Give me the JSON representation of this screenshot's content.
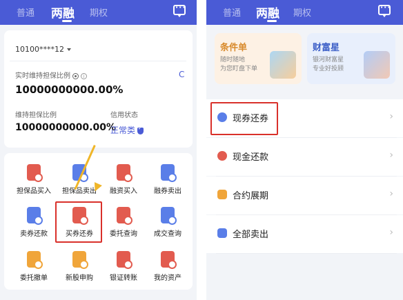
{
  "tabs": [
    "普通",
    "两融",
    "期权"
  ],
  "account": {
    "number": "10100****12"
  },
  "maintenance": {
    "realtime_label": "实时维持担保比例",
    "realtime_value": "10000000000.00%",
    "refresh": "C",
    "ratio_label": "维持担保比例",
    "ratio_value": "10000000000.00%",
    "credit_label": "信用状态",
    "credit_value": "正常类"
  },
  "grid": [
    {
      "label": "担保品买入",
      "icon": "collateral-buy-icon",
      "color": "red"
    },
    {
      "label": "担保品卖出",
      "icon": "collateral-sell-icon",
      "color": "blue"
    },
    {
      "label": "融资买入",
      "icon": "margin-buy-icon",
      "color": "red"
    },
    {
      "label": "融券卖出",
      "icon": "short-sell-icon",
      "color": "blue"
    },
    {
      "label": "卖券还款",
      "icon": "sell-repay-icon",
      "color": "blue"
    },
    {
      "label": "买券还券",
      "icon": "buy-return-icon",
      "color": "red"
    },
    {
      "label": "委托查询",
      "icon": "order-query-icon",
      "color": "red"
    },
    {
      "label": "成交查询",
      "icon": "trade-query-icon",
      "color": "blue"
    },
    {
      "label": "委托撤单",
      "icon": "cancel-order-icon",
      "color": "orange"
    },
    {
      "label": "新股申购",
      "icon": "ipo-subscribe-icon",
      "color": "orange"
    },
    {
      "label": "银证转账",
      "icon": "bank-transfer-icon",
      "color": "red"
    },
    {
      "label": "我的资产",
      "icon": "my-assets-icon",
      "color": "red"
    }
  ],
  "banners": [
    {
      "title": "条件单",
      "line1": "随时随地",
      "line2": "为您盯盘下单"
    },
    {
      "title": "财富星",
      "line1": "银河财富星",
      "line2": "专业好投顾"
    }
  ],
  "list": [
    {
      "label": "现券还券",
      "icon": "stock-return-icon",
      "color": "#5a7ee8"
    },
    {
      "label": "现金还款",
      "icon": "cash-repay-icon",
      "color": "#e25b4f"
    },
    {
      "label": "合约展期",
      "icon": "contract-extend-icon",
      "color": "#f0a53a"
    },
    {
      "label": "全部卖出",
      "icon": "sell-all-icon",
      "color": "#5a7ee8"
    }
  ],
  "colors": {
    "brand": "#4a5bd6",
    "highlight": "#d9302a",
    "arrow": "#f0b628"
  }
}
